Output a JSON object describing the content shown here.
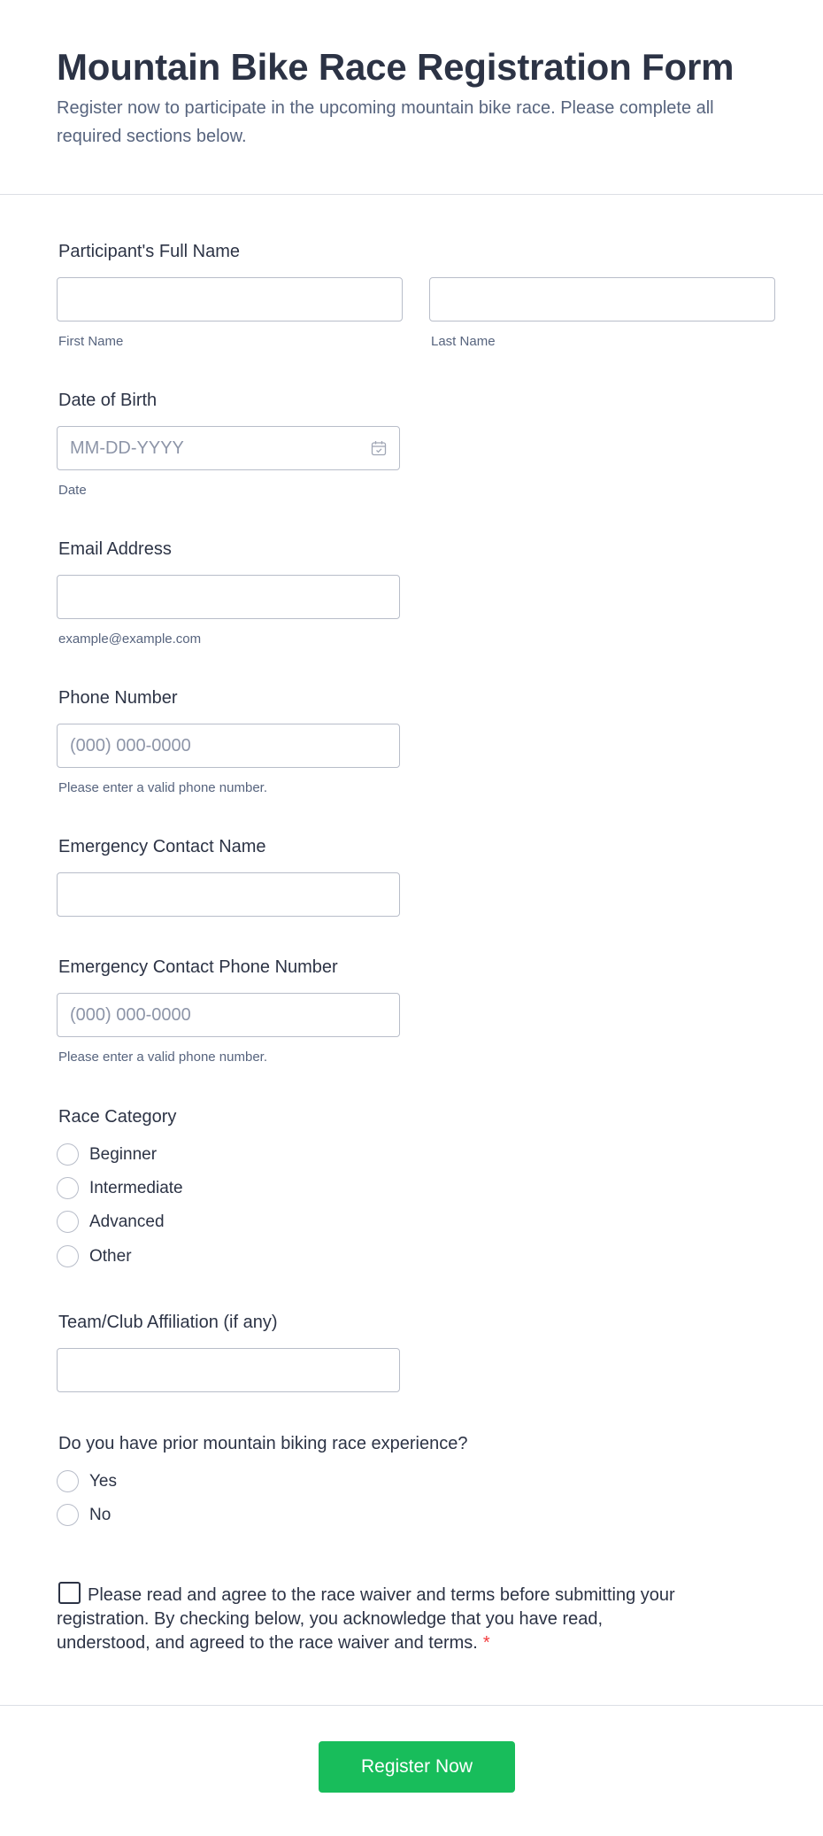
{
  "header": {
    "title": "Mountain Bike Race Registration Form",
    "subtitle": "Register now to participate in the upcoming mountain bike race. Please complete all required sections below."
  },
  "fields": {
    "full_name": {
      "label": "Participant's Full Name",
      "first_sublabel": "First Name",
      "last_sublabel": "Last Name"
    },
    "dob": {
      "label": "Date of Birth",
      "placeholder": "MM-DD-YYYY",
      "sublabel": "Date",
      "icon": "calendar-icon"
    },
    "email": {
      "label": "Email Address",
      "sublabel": "example@example.com"
    },
    "phone": {
      "label": "Phone Number",
      "placeholder": "(000) 000-0000",
      "sublabel": "Please enter a valid phone number."
    },
    "emergency_name": {
      "label": "Emergency Contact Name"
    },
    "emergency_phone": {
      "label": "Emergency Contact Phone Number",
      "placeholder": "(000) 000-0000",
      "sublabel": "Please enter a valid phone number."
    },
    "race_category": {
      "label": "Race Category",
      "options": [
        "Beginner",
        "Intermediate",
        "Advanced",
        "Other"
      ]
    },
    "team": {
      "label": "Team/Club Affiliation (if any)"
    },
    "experience": {
      "label": "Do you have prior mountain biking race experience?",
      "options": [
        "Yes",
        "No"
      ]
    },
    "terms": {
      "text": "Please read and agree to the race waiver and terms before submitting your registration. By checking below, you acknowledge that you have read, understood, and agreed to the race waiver and terms.",
      "required_mark": "*"
    }
  },
  "submit": {
    "label": "Register Now"
  },
  "colors": {
    "accent": "#18bd5b",
    "required": "#f23a3c",
    "text": "#2c3345",
    "muted": "#57647e",
    "border": "#b8bdc9"
  }
}
